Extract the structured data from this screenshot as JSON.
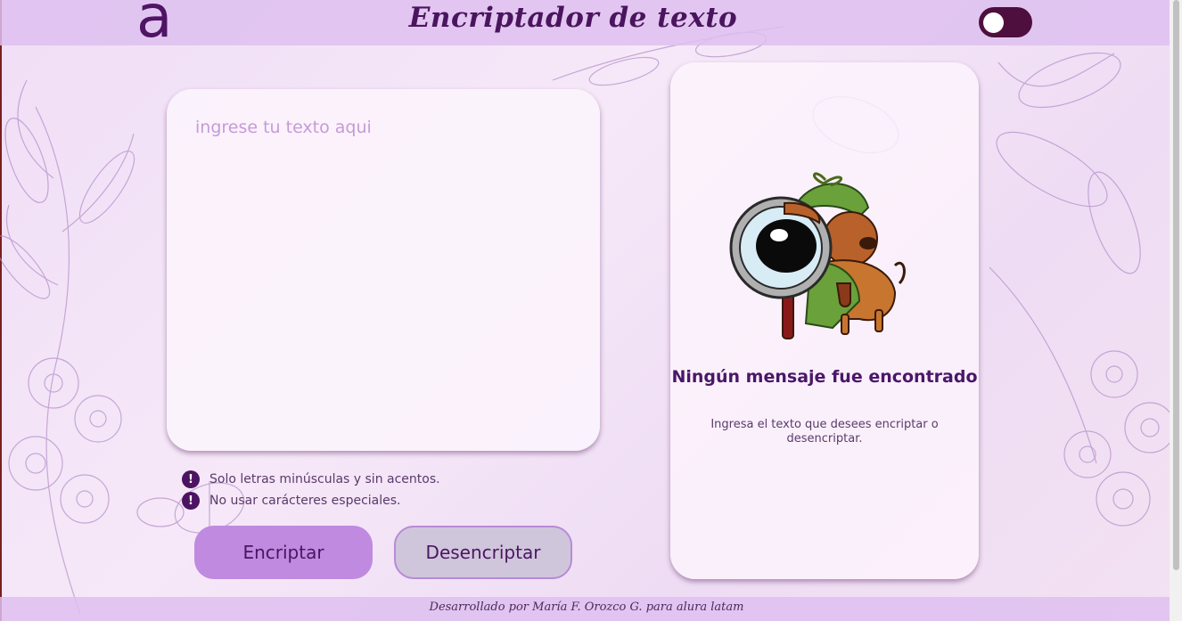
{
  "header": {
    "logo": "a",
    "title": "Encriptador de texto",
    "theme_toggle": "toggle-switch"
  },
  "input": {
    "placeholder": "ingrese tu texto aqui",
    "value": ""
  },
  "rules": [
    {
      "icon": "!",
      "text": "Solo letras minúsculas y sin acentos."
    },
    {
      "icon": "!",
      "text": "No usar carácteres especiales."
    }
  ],
  "buttons": {
    "encrypt_label": "Encriptar",
    "decrypt_label": "Desencriptar"
  },
  "output": {
    "image": "detective-dog-magnifying-glass",
    "title": "Ningún mensaje fue encontrado",
    "subtitle": "Ingresa el texto que desees encriptar o desencriptar."
  },
  "footer": {
    "text": "Desarrollado por María F. Orozco G. para alura latam"
  },
  "colors": {
    "brand": "#4f1464",
    "encrypt_button": "#bf8ae0",
    "decrypt_button": "#cfc6dc",
    "toggle": "#4f0f3e"
  }
}
